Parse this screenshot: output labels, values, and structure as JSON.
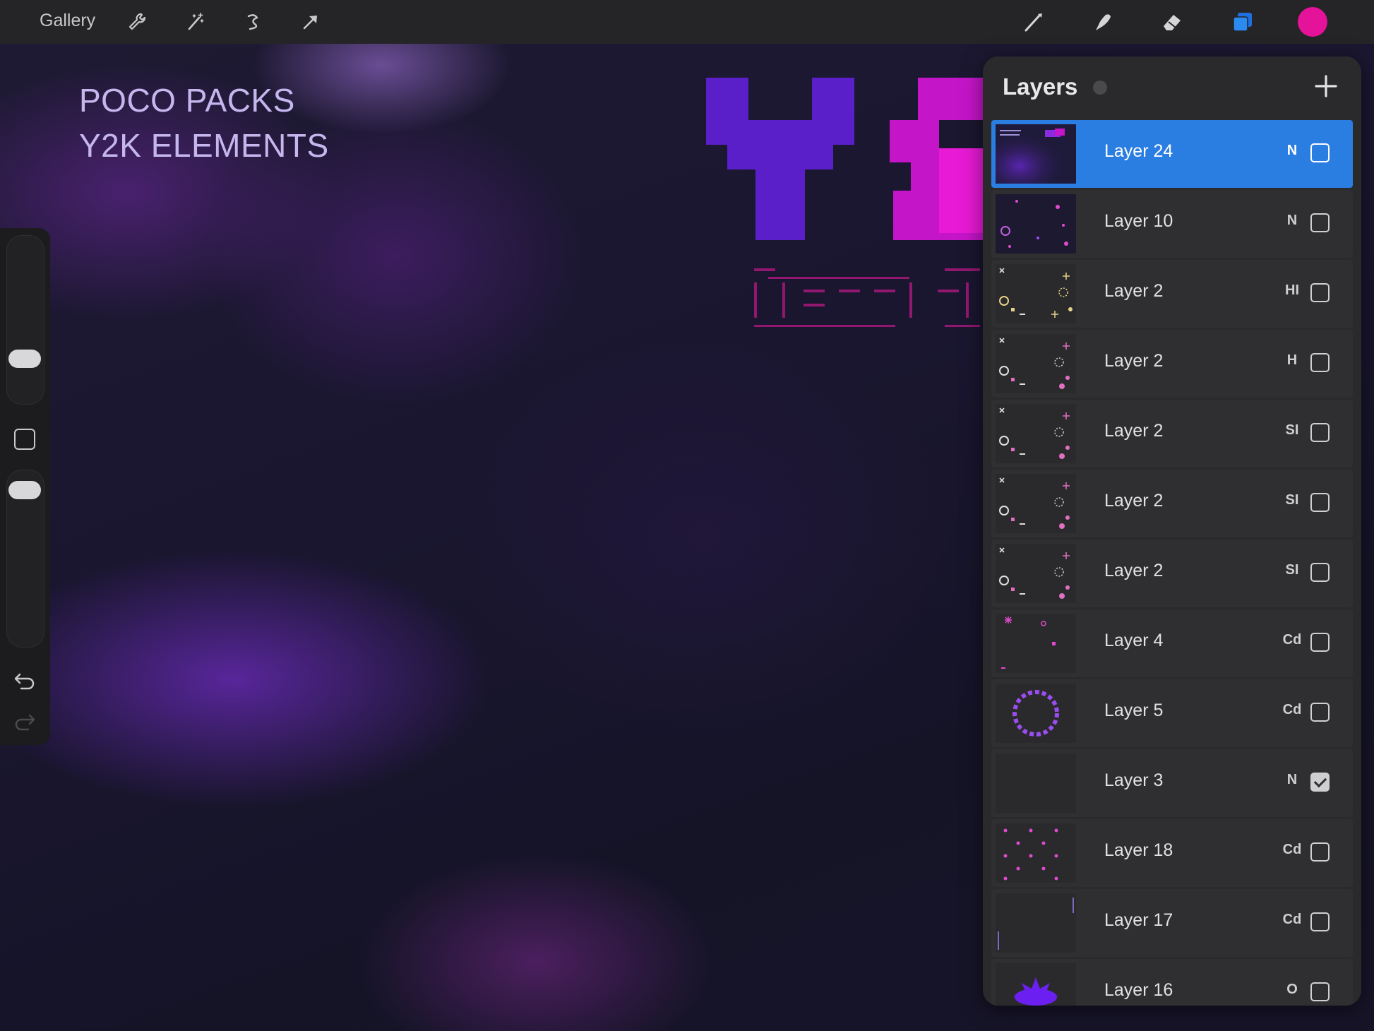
{
  "app": {
    "gallery_label": "Gallery",
    "toolbar_left_icons": [
      "wrench-icon",
      "magic-wand-icon",
      "selection-icon",
      "transform-arrow-icon"
    ],
    "toolbar_right_icons": [
      "brush-icon",
      "smudge-icon",
      "eraser-icon",
      "layers-icon"
    ],
    "current_color": "#e5129a",
    "accent_color": "#2a7de1"
  },
  "canvas": {
    "title_line1": "POCO PACKS",
    "title_line2": "Y2K ELEMENTS"
  },
  "sidebar": {
    "icons": [
      "brush-size-slider",
      "modify-button",
      "opacity-slider",
      "undo-icon",
      "redo-icon"
    ]
  },
  "layers_panel": {
    "title": "Layers",
    "add_icon": "plus-icon",
    "layers": [
      {
        "name": "Layer 24",
        "blend": "N",
        "visible": false,
        "selected": true,
        "thumb": "poster"
      },
      {
        "name": "Layer 10",
        "blend": "N",
        "visible": false,
        "selected": false,
        "thumb": "sparkles-dark"
      },
      {
        "name": "Layer 2",
        "blend": "HI",
        "visible": false,
        "selected": false,
        "thumb": "elements-gold"
      },
      {
        "name": "Layer 2",
        "blend": "H",
        "visible": false,
        "selected": false,
        "thumb": "elements-pink"
      },
      {
        "name": "Layer 2",
        "blend": "SI",
        "visible": false,
        "selected": false,
        "thumb": "elements-pink"
      },
      {
        "name": "Layer 2",
        "blend": "SI",
        "visible": false,
        "selected": false,
        "thumb": "elements-pink"
      },
      {
        "name": "Layer 2",
        "blend": "SI",
        "visible": false,
        "selected": false,
        "thumb": "elements-pink"
      },
      {
        "name": "Layer 4",
        "blend": "Cd",
        "visible": false,
        "selected": false,
        "thumb": "sparse-pink"
      },
      {
        "name": "Layer 5",
        "blend": "Cd",
        "visible": false,
        "selected": false,
        "thumb": "purple-ring"
      },
      {
        "name": "Layer 3",
        "blend": "N",
        "visible": true,
        "selected": false,
        "thumb": "empty"
      },
      {
        "name": "Layer 18",
        "blend": "Cd",
        "visible": false,
        "selected": false,
        "thumb": "pink-stars"
      },
      {
        "name": "Layer 17",
        "blend": "Cd",
        "visible": false,
        "selected": false,
        "thumb": "thin-lines"
      },
      {
        "name": "Layer 16",
        "blend": "O",
        "visible": false,
        "selected": false,
        "thumb": "purple-burst"
      }
    ]
  }
}
